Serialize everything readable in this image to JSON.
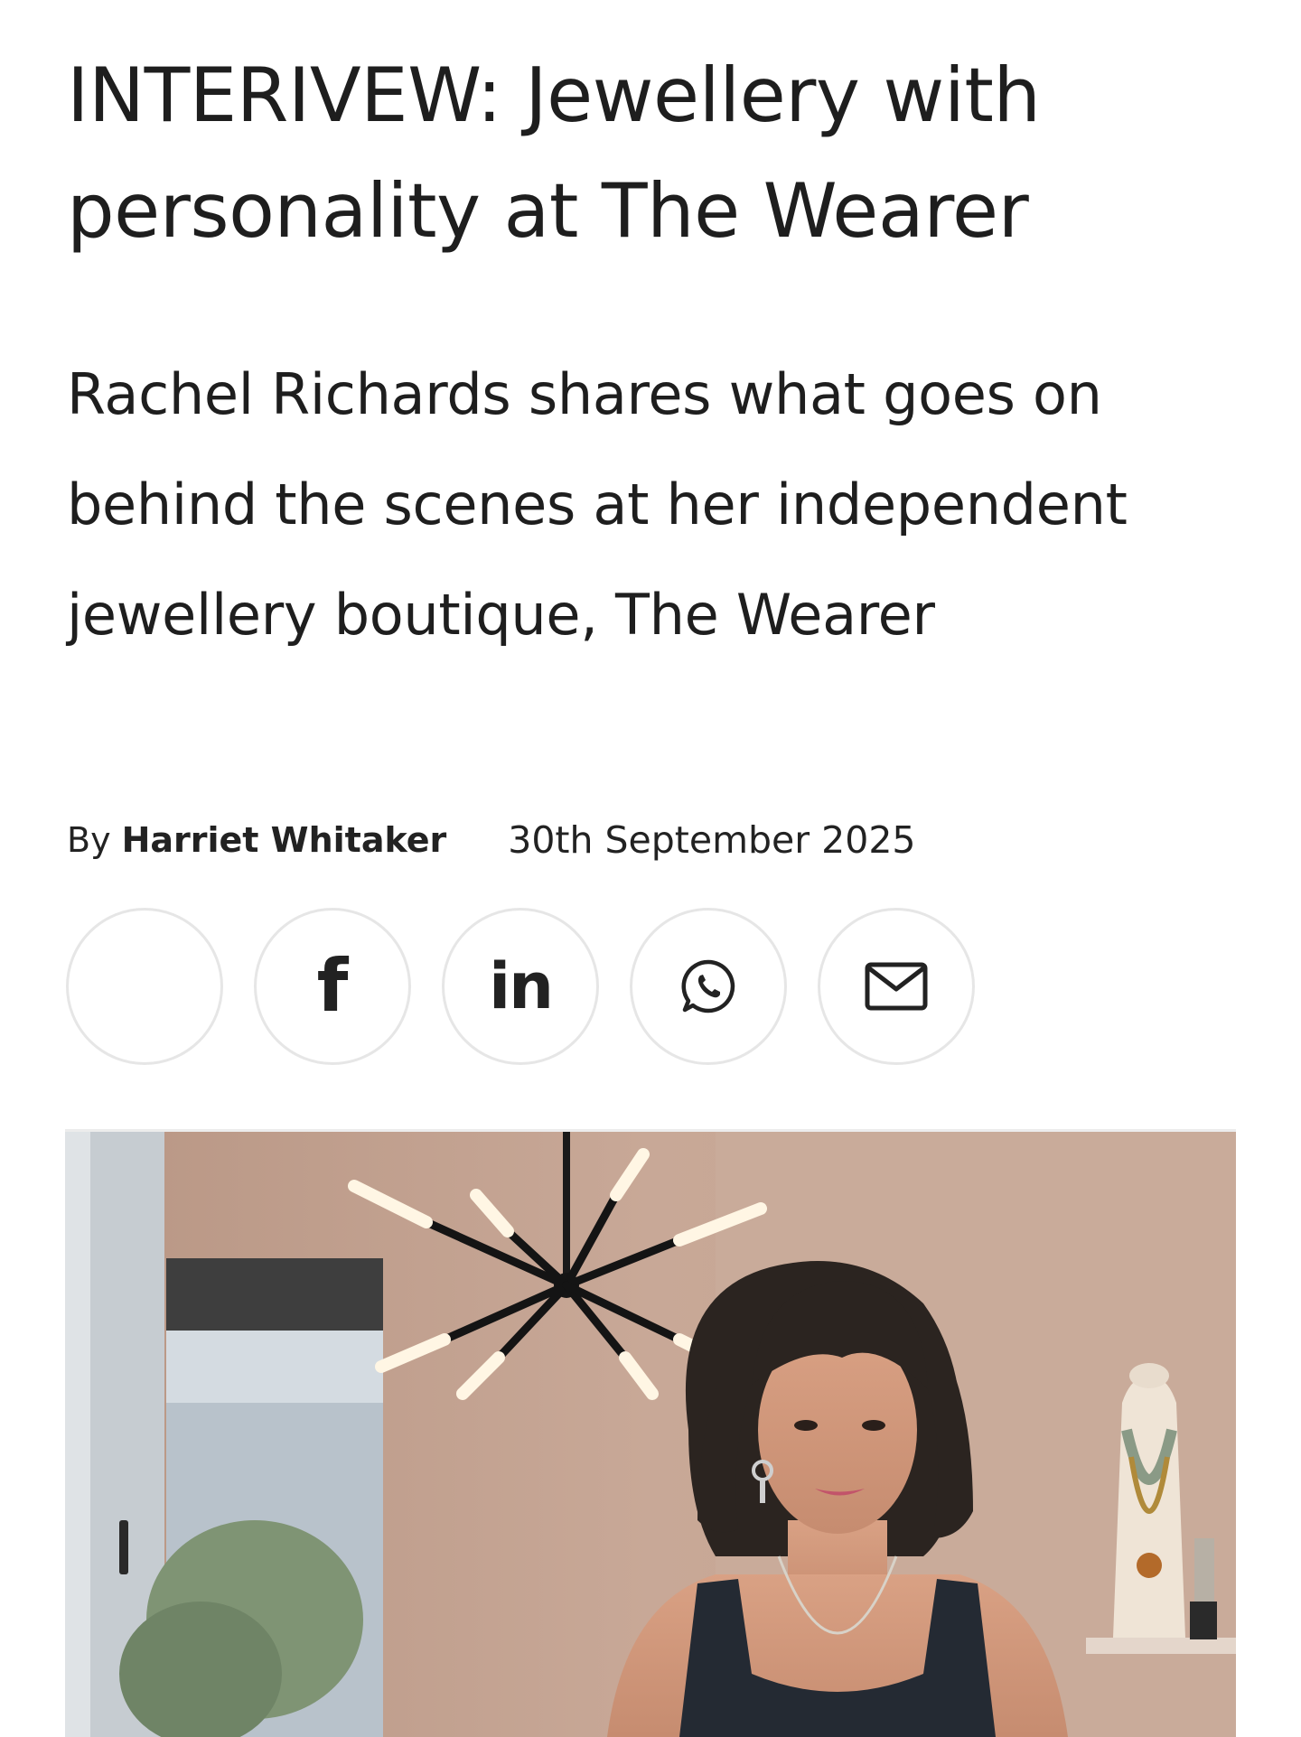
{
  "article": {
    "headline": "INTERIVEW: Jewellery with personality at The Wearer",
    "standfirst": "Rachel Richards shares what goes on behind the scenes at her independent jewellery boutique, The Wearer",
    "byline": {
      "prefix": "By",
      "author": "Harriet Whitaker",
      "date": "30th September 2025"
    }
  },
  "share": {
    "buttons": [
      {
        "name": "blank",
        "icon": "share-icon"
      },
      {
        "name": "facebook",
        "icon": "facebook-icon",
        "glyph": "f"
      },
      {
        "name": "linkedin",
        "icon": "linkedin-icon",
        "glyph": "in"
      },
      {
        "name": "whatsapp",
        "icon": "whatsapp-icon"
      },
      {
        "name": "email",
        "icon": "mail-icon"
      }
    ]
  },
  "colors": {
    "text": "#1e1e1e",
    "button_border": "#e6e6e6",
    "wall": "#c4a290"
  }
}
